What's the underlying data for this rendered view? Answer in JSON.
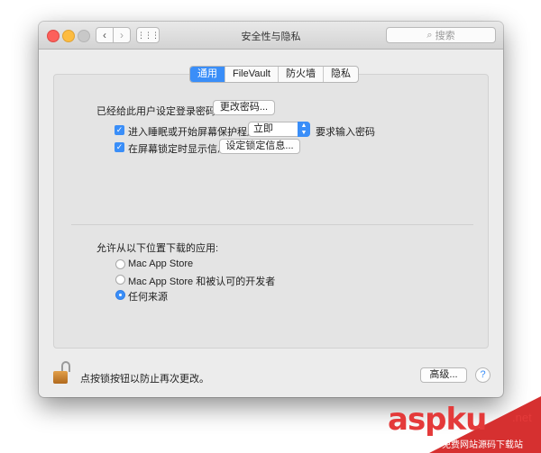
{
  "window": {
    "title": "安全性与隐私"
  },
  "toolbar": {
    "back_glyph": "‹",
    "forward_glyph": "›",
    "grid_glyph": "⋮⋮⋮",
    "search_placeholder": "搜索",
    "search_icon": "magnifier-icon"
  },
  "tabs": [
    {
      "label": "通用",
      "active": true
    },
    {
      "label": "FileVault",
      "active": false
    },
    {
      "label": "防火墙",
      "active": false
    },
    {
      "label": "隐私",
      "active": false
    }
  ],
  "general": {
    "password_label": "已经给此用户设定登录密码",
    "change_password_button": "更改密码...",
    "require_password_checkbox": {
      "label": "进入睡眠或开始屏幕保护程序",
      "checked": true
    },
    "require_password_select": {
      "value": "立即"
    },
    "require_password_suffix": "要求输入密码",
    "show_message_checkbox": {
      "label": "在屏幕锁定时显示信息",
      "checked": true
    },
    "set_message_button": "设定锁定信息...",
    "allow_apps_label": "允许从以下位置下载的应用:",
    "radio_options": [
      {
        "label": "Mac App Store",
        "selected": false
      },
      {
        "label": "Mac App Store 和被认可的开发者",
        "selected": false
      },
      {
        "label": "任何来源",
        "selected": true
      }
    ]
  },
  "footer": {
    "lock_text": "点按锁按钮以防止再次更改。",
    "advanced_button": "高级...",
    "help_glyph": "?"
  },
  "watermark": {
    "main": "aspku",
    "suffix": ".net",
    "sub": "免费网站源码下载站"
  },
  "colors": {
    "accent": "#3a8ef8",
    "watermark": "#e43a3a"
  }
}
